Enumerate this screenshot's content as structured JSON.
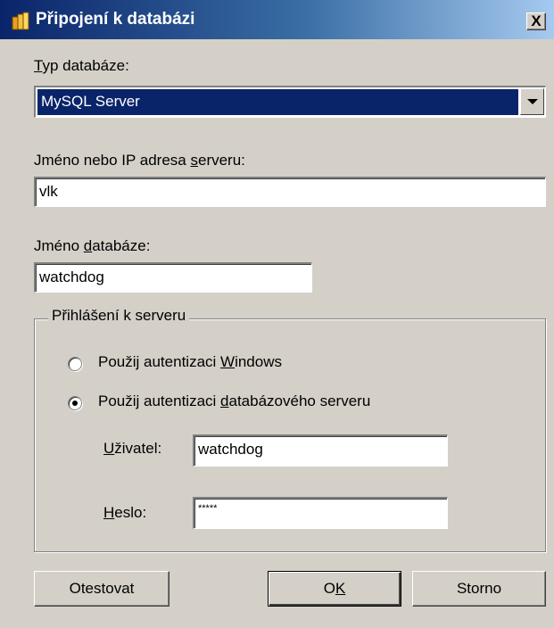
{
  "window": {
    "title": "Připojení k databázi",
    "close_label": "X"
  },
  "db_type": {
    "label_key": "T",
    "label_rest": "yp databáze:",
    "value": "MySQL Server"
  },
  "server": {
    "label_pre": "Jméno nebo IP adresa ",
    "label_key": "s",
    "label_post": "erveru:",
    "value": "vlk"
  },
  "database": {
    "label_pre": "Jméno ",
    "label_key": "d",
    "label_post": "atabáze:",
    "value": "watchdog"
  },
  "login": {
    "group_title": "Přihlášení k serveru",
    "radio_windows": {
      "pre": "Použij autentizaci ",
      "key": "W",
      "post": "indows",
      "checked": false
    },
    "radio_db": {
      "pre": "Použij autentizaci ",
      "key": "d",
      "post": "atabázového serveru",
      "checked": true
    },
    "user": {
      "label_key": "U",
      "label_rest": "živatel:",
      "value": "watchdog"
    },
    "password": {
      "label_key": "H",
      "label_rest": "eslo:",
      "value": "*****"
    }
  },
  "buttons": {
    "test": "Otestovat",
    "ok_pre": "O",
    "ok_key": "K",
    "cancel": "Storno"
  },
  "colors": {
    "face": "#d4d0c8",
    "title_start": "#0a246a",
    "title_end": "#a6caf0",
    "selection": "#0a246a"
  },
  "icons": {
    "title": "database-icon",
    "close": "close-icon",
    "dropdown": "chevron-down-icon"
  }
}
